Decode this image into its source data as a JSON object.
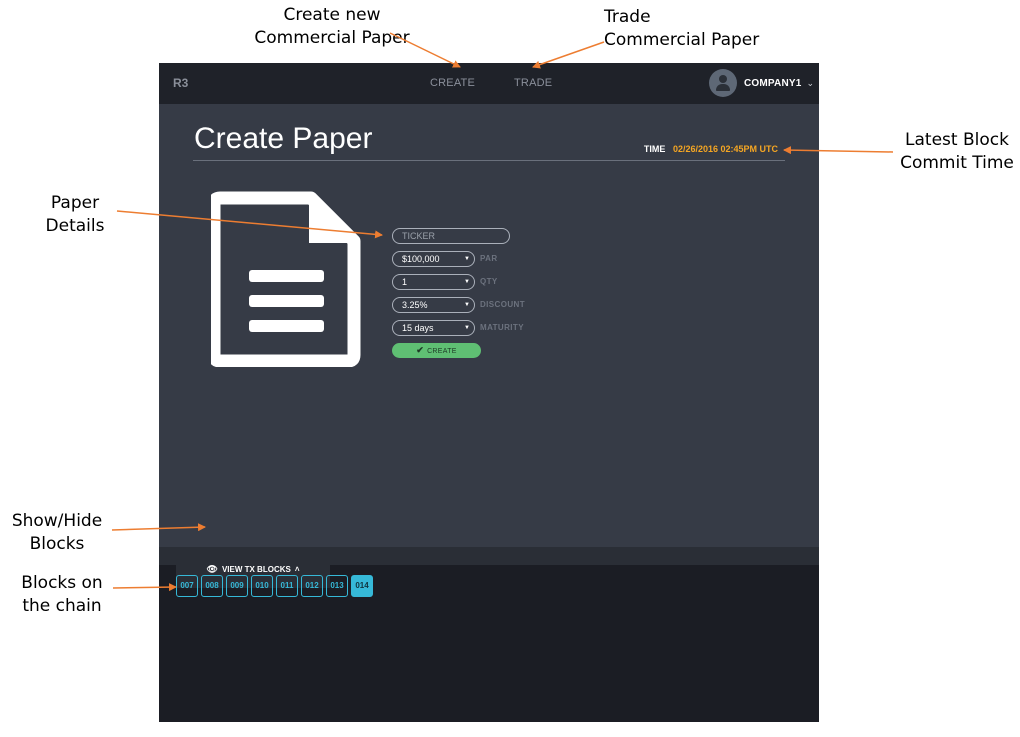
{
  "callouts": {
    "create": [
      "Create new",
      "Commercial Paper"
    ],
    "trade": [
      "Trade",
      "Commercial Paper"
    ],
    "block_time": [
      "Latest Block",
      "Commit Time"
    ],
    "paper": [
      "Paper",
      "Details"
    ],
    "toggle": [
      "Show/Hide",
      "Blocks"
    ],
    "chain": [
      "Blocks on",
      "the chain"
    ]
  },
  "app": {
    "brand": "R3",
    "nav": {
      "create": "CREATE",
      "trade": "TRADE"
    },
    "user": {
      "name": "COMPANY1",
      "caret": "⌄"
    }
  },
  "page": {
    "title": "Create Paper",
    "time_label": "TIME",
    "time_value": "02/26/2016  02:45PM UTC"
  },
  "form": {
    "ticker_placeholder": "TICKER",
    "par": {
      "value": "$100,000",
      "label": "PAR"
    },
    "qty": {
      "value": "1",
      "label": "QTY"
    },
    "discount": {
      "value": "3.25%",
      "label": "DISCOUNT"
    },
    "maturity": {
      "value": "15 days",
      "label": "MATURITY"
    },
    "create_label": "CREATE"
  },
  "blocks_toggle": {
    "label": "VIEW TX BLOCKS",
    "caret": "˄"
  },
  "blocks": [
    "007",
    "008",
    "009",
    "010",
    "011",
    "012",
    "013",
    "014"
  ],
  "active_block": "014",
  "colors": {
    "annotation_arrow": "#ed7d31",
    "time_accent": "#f5a623",
    "block_accent": "#36b9d8",
    "create_button": "#5fbf73"
  },
  "icons": [
    "user-avatar-icon",
    "document-icon",
    "eye-icon",
    "checkmark-icon",
    "dropdown-arrow-icon",
    "chevron-down-icon",
    "chevron-up-icon"
  ]
}
